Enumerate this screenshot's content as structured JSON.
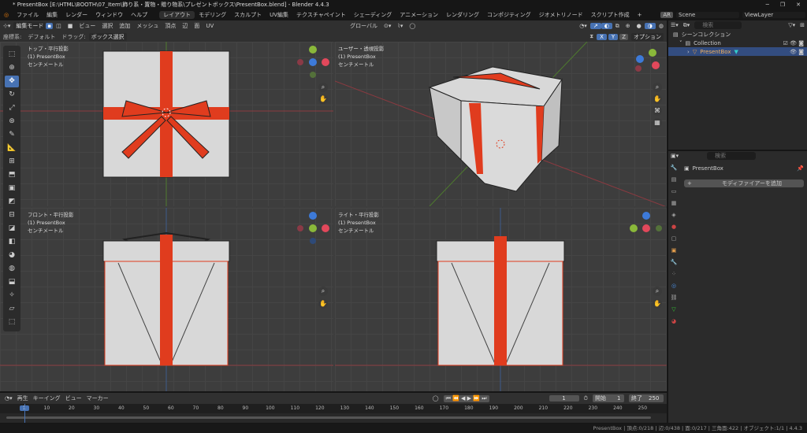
{
  "window": {
    "title": "* PresentBox [E:\\HTML\\BOOTH\\07_Item\\飾り系・置物・贈り物系\\プレゼントボックス\\PresentBox.blend] - Blender 4.4.3",
    "minimize": "─",
    "maximize": "❐",
    "close": "✕"
  },
  "menu": [
    "ファイル",
    "編集",
    "レンダー",
    "ウィンドウ",
    "ヘルプ"
  ],
  "workspaces": [
    "レイアウト",
    "モデリング",
    "スカルプト",
    "UV編集",
    "テクスチャペイント",
    "シェーディング",
    "アニメーション",
    "レンダリング",
    "コンポジティング",
    "ジオメトリノード",
    "スクリプト作成",
    "+"
  ],
  "scene": {
    "ar": "AR",
    "scene": "Scene",
    "view_layer": "ViewLayer"
  },
  "header": {
    "mode": "編集モード",
    "menus": [
      "ビュー",
      "選択",
      "追加",
      "メッシュ",
      "頂点",
      "辺",
      "面",
      "UV"
    ],
    "orientation": "グローバル",
    "options": "オプション",
    "axes": [
      "X",
      "Y",
      "Z"
    ]
  },
  "tool_settings": {
    "coord_label": "座標系:",
    "coord_value": "デフォルト",
    "drag_label": "ドラッグ:",
    "drag_value": "ボックス選択"
  },
  "viewports": [
    {
      "name": "トップ・平行投影",
      "object": "(1) PresentBox",
      "unit": "センチメートル"
    },
    {
      "name": "ユーザー・透視投影",
      "object": "(1) PresentBox",
      "unit": "センチメートル"
    },
    {
      "name": "フロント・平行投影",
      "object": "(1) PresentBox",
      "unit": "センチメートル"
    },
    {
      "name": "ライト・平行投影",
      "object": "(1) PresentBox",
      "unit": "センチメートル"
    }
  ],
  "outliner": {
    "search_placeholder": "検索",
    "scene_collection": "シーンコレクション",
    "collection": "Collection",
    "object": "PresentBox"
  },
  "properties": {
    "search_placeholder": "検索",
    "object": "PresentBox",
    "add_modifier": "モディファイアーを追加"
  },
  "timeline": {
    "menus": [
      "再生",
      "キーイング",
      "ビュー",
      "マーカー"
    ],
    "current_frame": "1",
    "start_label": "開始",
    "start": "1",
    "end_label": "終了",
    "end": "250",
    "ticks": [
      "1",
      "10",
      "20",
      "30",
      "40",
      "50",
      "60",
      "70",
      "80",
      "90",
      "100",
      "110",
      "120",
      "130",
      "140",
      "150",
      "160",
      "170",
      "180",
      "190",
      "200",
      "210",
      "220",
      "230",
      "240",
      "250"
    ]
  },
  "status": "PresentBox | 頂点:0/218 | 辺:0/438 | 面:0/217 | 三角面:422 | オブジェクト:1/1 | 4.4.3",
  "colors": {
    "accent": "#4772b3",
    "ribbon": "#e03c1e",
    "box": "#d6d6d6"
  }
}
